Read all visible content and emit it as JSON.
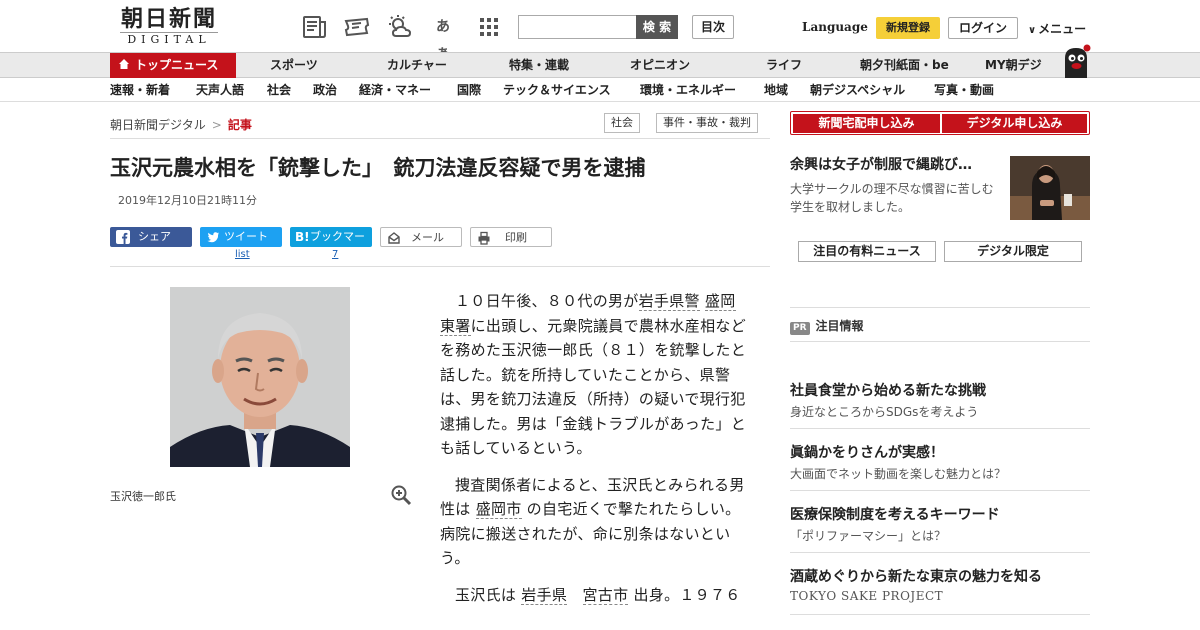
{
  "header": {
    "logo_kanji": "朝日新聞",
    "logo_sub": "DIGITAL",
    "font_size_label": "あぁ",
    "search_placeholder": "",
    "search_button": "検 索",
    "mokuji": "目次",
    "language": "Language",
    "register": "新規登録",
    "login": "ログイン",
    "menu": "メニュー"
  },
  "nav1": {
    "top_news": "トップニュース",
    "items": [
      "スポーツ",
      "カルチャー",
      "特集・連載",
      "オピニオン",
      "ライフ",
      "朝夕刊紙面・be",
      "MY朝デジ"
    ]
  },
  "nav2": {
    "items": [
      "速報・新着",
      "天声人語",
      "社会",
      "政治",
      "経済・マネー",
      "国際",
      "テック＆サイエンス",
      "環境・エネルギー",
      "地域",
      "朝デジスペシャル",
      "写真・動画"
    ]
  },
  "breadcrumb": {
    "home": "朝日新聞デジタル",
    "sep": ">",
    "current": "記事"
  },
  "tags": [
    "社会",
    "事件・事故・裁判"
  ],
  "article": {
    "title": "玉沢元農水相を「銃撃した」　銃刀法違反容疑で男を逮捕",
    "date": "2019年12月10日21時11分",
    "share": {
      "facebook": "シェア",
      "twitter": "ツイート",
      "twitter_sub": "list",
      "hatena": "ブックマーク",
      "hatena_sub": "7",
      "mail": "メール",
      "print": "印刷"
    },
    "photo_caption": "玉沢徳一郎氏",
    "p1a": "１０日午後、８０代の男が",
    "p1_link1": "岩手県警",
    "p1_link2": "盛岡東署",
    "p1b": "に出頭し、元衆院議員で農林水産相などを務めた玉沢徳一郎氏（８１）を銃撃したと話した。銃を所持していたことから、県警は、男を銃刀法違反（所持）の疑いで現行犯逮捕した。男は「金銭トラブルがあった」とも話しているという。",
    "p2a": "捜査関係者によると、玉沢氏とみられる男性は",
    "p2_link": "盛岡市",
    "p2b": "の自宅近くで撃たれたらしい。病院に搬送されたが、命に別条はないという。",
    "p3a": "玉沢氏は",
    "p3_link1": "岩手県",
    "p3_link2": "宮古市",
    "p3b": "出身。１９７６"
  },
  "sidebar": {
    "subscribe_paper": "新聞宅配申し込み",
    "subscribe_digital": "デジタル申し込み",
    "featured_title": "余興は女子が制服で縄跳び…",
    "featured_desc": "大学サークルの理不尽な慣習に苦しむ学生を取材しました。",
    "btn_paid": "注目の有料ニュース",
    "btn_digital": "デジタル限定",
    "pr_badge": "PR",
    "pr_heading": "注目情報",
    "pr_items": [
      {
        "title": "社員食堂から始める新たな挑戦",
        "desc": "身近なところからSDGsを考えよう"
      },
      {
        "title": "眞鍋かをりさんが実感！",
        "desc": "大画面でネット動画を楽しむ魅力とは？"
      },
      {
        "title": "医療保険制度を考えるキーワード",
        "desc": "「ポリファーマシー」とは？"
      },
      {
        "title": "酒蔵めぐりから新たな東京の魅力を知る",
        "desc": "TOKYO SAKE PROJECT"
      }
    ]
  },
  "colors": {
    "brand_red": "#c4121b",
    "register_yellow": "#f5cf38",
    "facebook": "#3b5998",
    "twitter": "#1da1f2",
    "hatena": "#0ea0de"
  }
}
